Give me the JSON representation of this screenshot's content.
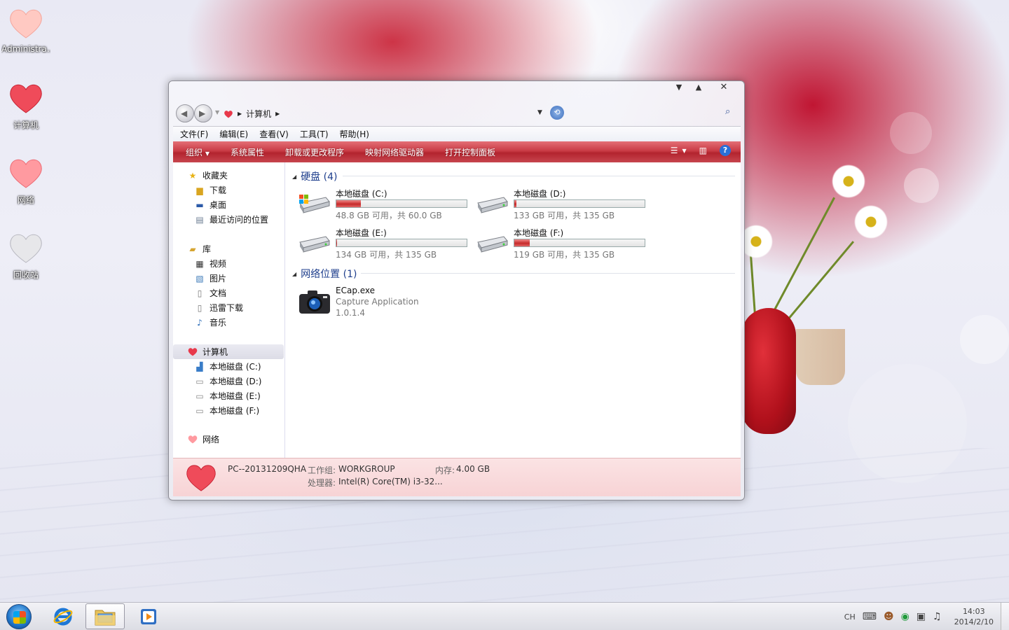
{
  "desktop": {
    "icons": [
      {
        "label": "Administra..."
      },
      {
        "label": "计算机"
      },
      {
        "label": "网络"
      },
      {
        "label": "回收站"
      }
    ]
  },
  "window": {
    "breadcrumb": [
      "计算机"
    ],
    "menu": [
      "文件(F)",
      "编辑(E)",
      "查看(V)",
      "工具(T)",
      "帮助(H)"
    ],
    "toolbar": [
      "组织",
      "系统属性",
      "卸载或更改程序",
      "映射网络驱动器",
      "打开控制面板"
    ],
    "help_label": "?",
    "nav": {
      "favorites": "收藏夹",
      "favorites_items": [
        "下载",
        "桌面",
        "最近访问的位置"
      ],
      "library": "库",
      "library_items": [
        "视频",
        "图片",
        "文档",
        "迅雷下载",
        "音乐"
      ],
      "computer": "计算机",
      "computer_items": [
        "本地磁盘 (C:)",
        "本地磁盘 (D:)",
        "本地磁盘 (E:)",
        "本地磁盘 (F:)"
      ],
      "network": "网络"
    },
    "groups": {
      "drives_title": "硬盘 (4)",
      "network_title": "网络位置 (1)"
    },
    "drives": [
      {
        "name": "本地磁盘 (C:)",
        "free": "48.8 GB 可用，共 60.0 GB",
        "used_fraction": 0.19
      },
      {
        "name": "本地磁盘 (D:)",
        "free": "133 GB 可用，共 135 GB",
        "used_fraction": 0.015
      },
      {
        "name": "本地磁盘 (E:)",
        "free": "134 GB 可用，共 135 GB",
        "used_fraction": 0.007
      },
      {
        "name": "本地磁盘 (F:)",
        "free": "119 GB 可用，共 135 GB",
        "used_fraction": 0.12
      }
    ],
    "network_item": {
      "name": "ECap.exe",
      "desc": "Capture Application",
      "version": "1.0.1.4"
    },
    "status": {
      "pc_name": "PC--20131209QHA",
      "workgroup_label": "工作组:",
      "workgroup": "WORKGROUP",
      "memory_label": "内存:",
      "memory": "4.00 GB",
      "cpu_label": "处理器:",
      "cpu": "Intel(R) Core(TM) i3-32..."
    }
  },
  "taskbar": {
    "lang": "CH",
    "time": "14:03",
    "date": "2014/2/10"
  },
  "colors": {
    "accent_red": "#c93b45",
    "group_title_blue": "#1e3e8c"
  }
}
